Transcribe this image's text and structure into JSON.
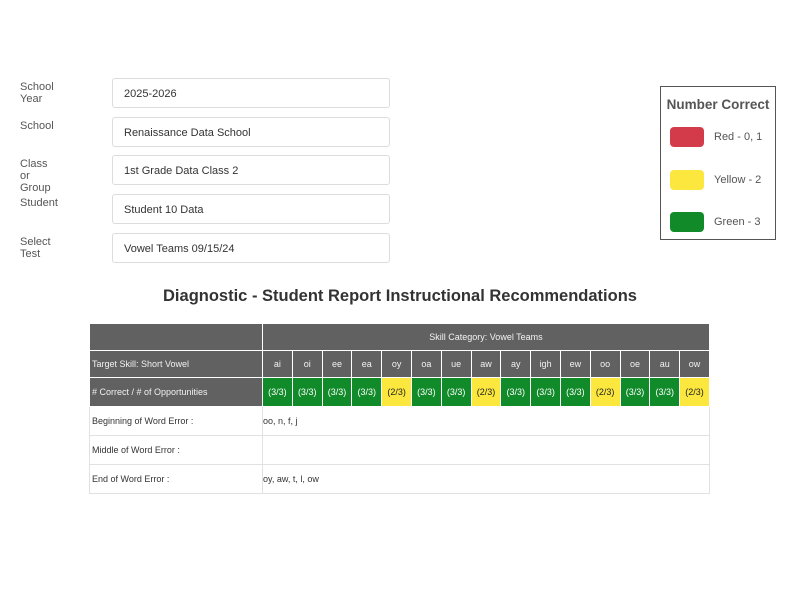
{
  "filters": [
    {
      "label": "School Year",
      "value": "2025-2026"
    },
    {
      "label": "School",
      "value": "Renaissance Data School"
    },
    {
      "label": "Class or Group",
      "value": "1st Grade Data Class 2"
    },
    {
      "label": "Student",
      "value": "Student 10 Data"
    },
    {
      "label": "Select Test",
      "value": "Vowel Teams 09/15/24"
    }
  ],
  "legend": {
    "title": "Number Correct",
    "items": [
      {
        "label": "Red - 0, 1",
        "color": "#d43b4a"
      },
      {
        "label": "Yellow - 2",
        "color": "#fbe73e"
      },
      {
        "label": "Green - 3",
        "color": "#118a2a"
      }
    ]
  },
  "report": {
    "title": "Diagnostic - Student Report Instructional Recommendations",
    "skill_category": "Skill Category: Vowel Teams",
    "target_skill": "Target Skill: Short Vowel",
    "skills": [
      "ai",
      "oi",
      "ee",
      "ea",
      "oy",
      "oa",
      "ue",
      "aw",
      "ay",
      "igh",
      "ew",
      "oo",
      "oe",
      "au",
      "ow"
    ],
    "scores_label": "# Correct / # of Opportunities",
    "scores": [
      {
        "text": "(3/3)",
        "level": "green"
      },
      {
        "text": "(3/3)",
        "level": "green"
      },
      {
        "text": "(3/3)",
        "level": "green"
      },
      {
        "text": "(3/3)",
        "level": "green"
      },
      {
        "text": "(2/3)",
        "level": "yellow"
      },
      {
        "text": "(3/3)",
        "level": "green"
      },
      {
        "text": "(3/3)",
        "level": "green"
      },
      {
        "text": "(2/3)",
        "level": "yellow"
      },
      {
        "text": "(3/3)",
        "level": "green"
      },
      {
        "text": "(3/3)",
        "level": "green"
      },
      {
        "text": "(3/3)",
        "level": "green"
      },
      {
        "text": "(2/3)",
        "level": "yellow"
      },
      {
        "text": "(3/3)",
        "level": "green"
      },
      {
        "text": "(3/3)",
        "level": "green"
      },
      {
        "text": "(2/3)",
        "level": "yellow"
      }
    ],
    "errors": [
      {
        "label": "Beginning of Word Error :",
        "value": "oo, n, f, j"
      },
      {
        "label": "Middle of Word Error :",
        "value": ""
      },
      {
        "label": "End of Word Error :",
        "value": "oy, aw, t, l, ow"
      }
    ]
  }
}
